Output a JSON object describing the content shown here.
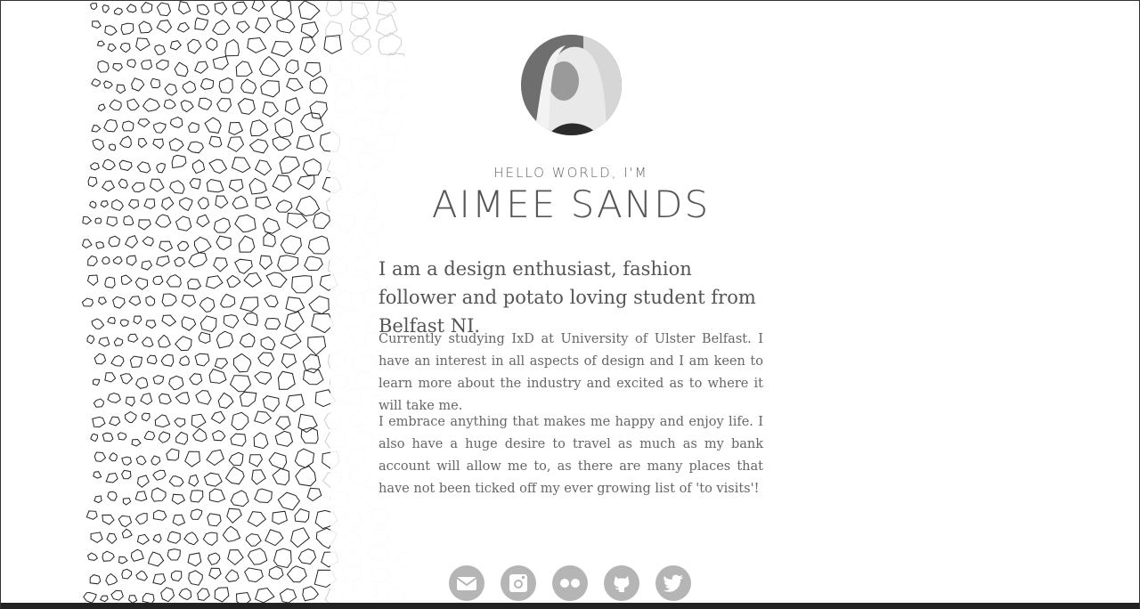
{
  "profile": {
    "avatar_alt": "Aimee Sands portrait",
    "kicker": "HELLO WORLD, I'M",
    "name": "AIMEE SANDS"
  },
  "about": {
    "lead": "I am a design enthusiast, fashion follower and potato loving student from Belfast NI.",
    "para1": "Currently studying IxD at University of Ulster Belfast. I have an interest in all aspects of design and I am keen to learn more about the industry and excited as to where it will take me.",
    "para2": "I embrace anything that makes me happy and enjoy life. I also have a huge desire to travel as much as my bank account will allow me to, as there are many places that have not been ticked off my ever growing list of 'to visits'!"
  },
  "social": [
    {
      "icon": "mail-icon"
    },
    {
      "icon": "instagram-icon"
    },
    {
      "icon": "flickr-icon"
    },
    {
      "icon": "github-icon"
    },
    {
      "icon": "twitter-icon"
    }
  ],
  "colors": {
    "text": "#555555",
    "social_bg": "#b5b5b5",
    "pattern_stroke": "#222222"
  }
}
